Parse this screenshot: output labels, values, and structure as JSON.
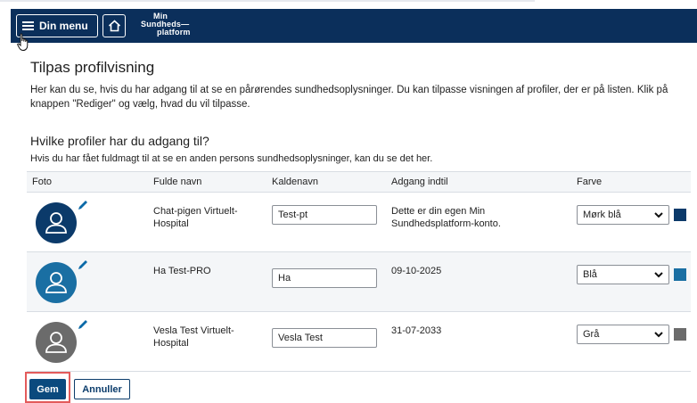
{
  "header": {
    "menu_label": "Din menu",
    "logo_line1": "Min",
    "logo_line2": "Sundheds—",
    "logo_line3": "platform",
    "bg_color": "#0b2f5b"
  },
  "page": {
    "title": "Tilpas profilvisning",
    "intro": "Her kan du se, hvis du har adgang til at se en pårørendes sundhedsoplysninger. Du kan tilpasse visningen af profiler, der er på listen. Klik på knappen \"Rediger\" og vælg, hvad du vil tilpasse."
  },
  "section": {
    "title": "Hvilke profiler har du adgang til?",
    "subtitle": "Hvis du har fået fuldmagt til at se en anden persons sundhedsoplysninger, kan du se det her."
  },
  "table": {
    "headers": {
      "photo": "Foto",
      "name": "Fulde navn",
      "nickname": "Kaldenavn",
      "access": "Adgang indtil",
      "color": "Farve"
    },
    "rows": [
      {
        "name": "Chat-pigen Virtuelt-Hospital",
        "nickname": "Test-pt",
        "access": "Dette er din egen Min Sundhedsplatform-konto.",
        "color_label": "Mørk blå",
        "color": "#0b3a6a",
        "avatar_icon": "person-icon"
      },
      {
        "name": "Ha Test-PRO",
        "nickname": "Ha",
        "access": "09-10-2025",
        "color_label": "Blå",
        "color": "#1a6fa3",
        "avatar_icon": "person-icon"
      },
      {
        "name": "Vesla Test Virtuelt-Hospital",
        "nickname": "Vesla Test",
        "access": "31-07-2033",
        "color_label": "Grå",
        "color": "#6b6b6b",
        "avatar_icon": "person-icon"
      }
    ]
  },
  "actions": {
    "save_label": "Gem",
    "cancel_label": "Annuller",
    "save_color": "#0b4a7e",
    "highlight_color": "#e35b5b"
  }
}
